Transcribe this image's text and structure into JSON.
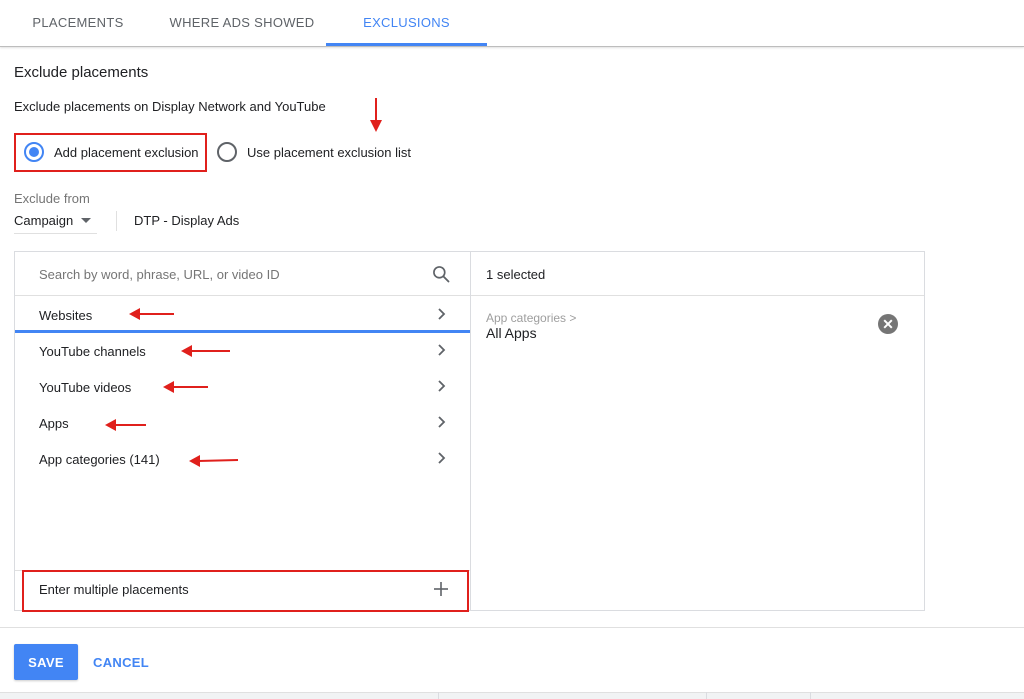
{
  "tabs": [
    {
      "label": "PLACEMENTS"
    },
    {
      "label": "WHERE ADS SHOWED"
    },
    {
      "label": "EXCLUSIONS"
    }
  ],
  "section": {
    "title": "Exclude placements",
    "subtitle": "Exclude placements on Display Network and YouTube"
  },
  "radios": {
    "add_exclusion": "Add placement exclusion",
    "use_list": "Use placement exclusion list",
    "selected": "Add placement exclusion"
  },
  "exclude_from": {
    "label": "Exclude from",
    "value": "Campaign",
    "campaign_name": "DTP - Display Ads"
  },
  "search": {
    "placeholder": "Search by word, phrase, URL, or video ID"
  },
  "categories": [
    {
      "label": "Websites"
    },
    {
      "label": "YouTube channels"
    },
    {
      "label": "YouTube videos"
    },
    {
      "label": "Apps"
    },
    {
      "label": "App categories (141)"
    }
  ],
  "enter_multiple": "Enter multiple placements",
  "selected_panel": {
    "count_label": "1 selected",
    "breadcrumb": "App categories >",
    "item": "All Apps"
  },
  "buttons": {
    "save": "SAVE",
    "cancel": "CANCEL"
  },
  "colors": {
    "accent": "#4285f4",
    "annotation_red": "#e0201c"
  },
  "icons": [
    "search-icon",
    "chevron-right-icon",
    "plus-icon",
    "remove-circle-icon",
    "dropdown-caret-icon"
  ]
}
